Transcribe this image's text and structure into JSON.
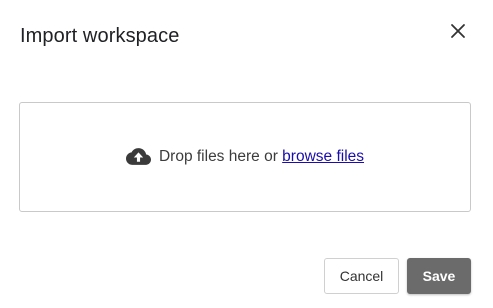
{
  "dialog": {
    "title": "Import workspace",
    "close_icon": "close-icon"
  },
  "dropzone": {
    "icon": "cloud-upload-icon",
    "prompt_text": "Drop files here or ",
    "browse_link_label": "browse files"
  },
  "footer": {
    "cancel_label": "Cancel",
    "save_label": "Save"
  },
  "colors": {
    "link": "#1a0dab",
    "save_bg": "#6b6b6b",
    "border": "#c9c9c9"
  }
}
